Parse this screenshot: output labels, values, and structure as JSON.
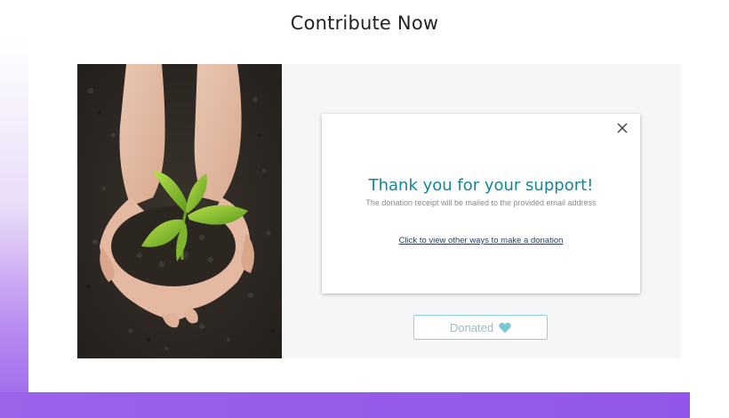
{
  "page": {
    "title": "Contribute Now"
  },
  "image": {
    "icon": "seedling-in-hands-photo"
  },
  "modal": {
    "heading": "Thank you for your support!",
    "subtext": "The donation receipt will be mailed to the provided email address",
    "link_text": "Click to view other ways to make a donation",
    "close_icon": "close-icon"
  },
  "donate_button": {
    "label": "Donated",
    "icon": "heart-icon"
  },
  "colors": {
    "accent": "#12869a",
    "button_border": "#8fcfdd",
    "heart": "#7cc7d6",
    "gradient": "#9a63ea",
    "panel_bg": "#f4f6f8"
  }
}
